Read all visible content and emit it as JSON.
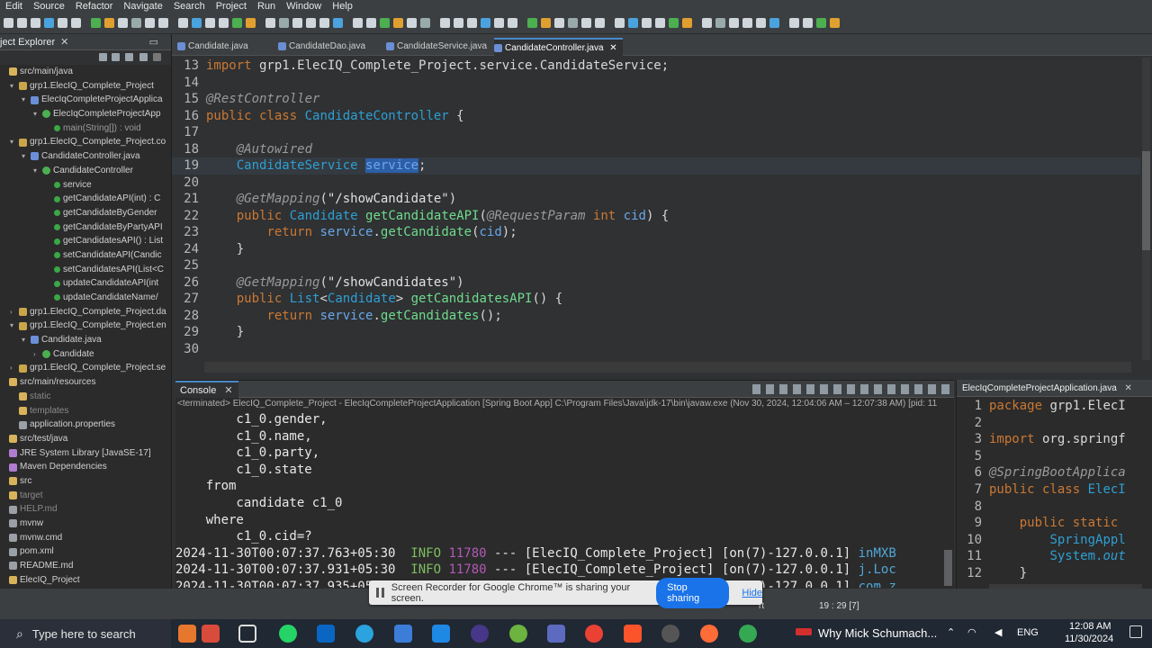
{
  "menu": [
    "Edit",
    "Source",
    "Refactor",
    "Navigate",
    "Search",
    "Project",
    "Run",
    "Window",
    "Help"
  ],
  "project_explorer": {
    "title": "ject Explorer",
    "rows": [
      {
        "indent": 0,
        "arrow": "",
        "icon": "fold",
        "text": "src/main/java",
        "cls": ""
      },
      {
        "indent": 1,
        "arrow": "▾",
        "icon": "pkg",
        "text": "grp1.ElecIQ_Complete_Project",
        "cls": ""
      },
      {
        "indent": 2,
        "arrow": "▾",
        "icon": "java",
        "text": "ElecIqCompleteProjectApplica",
        "cls": ""
      },
      {
        "indent": 3,
        "arrow": "▾",
        "icon": "cls",
        "text": "ElecIqCompleteProjectApp",
        "cls": ""
      },
      {
        "indent": 4,
        "arrow": "",
        "icon": "meth",
        "text": "main(String[]) : void",
        "cls": "main"
      },
      {
        "indent": 1,
        "arrow": "▾",
        "icon": "pkg",
        "text": "grp1.ElecIQ_Complete_Project.co",
        "cls": ""
      },
      {
        "indent": 2,
        "arrow": "▾",
        "icon": "java",
        "text": "CandidateController.java",
        "cls": ""
      },
      {
        "indent": 3,
        "arrow": "▾",
        "icon": "cls",
        "text": "CandidateController",
        "cls": ""
      },
      {
        "indent": 4,
        "arrow": "",
        "icon": "meth",
        "text": "service",
        "cls": ""
      },
      {
        "indent": 4,
        "arrow": "",
        "icon": "meth",
        "text": "getCandidateAPI(int) : C",
        "cls": ""
      },
      {
        "indent": 4,
        "arrow": "",
        "icon": "meth",
        "text": "getCandidateByGender",
        "cls": ""
      },
      {
        "indent": 4,
        "arrow": "",
        "icon": "meth",
        "text": "getCandidateByPartyAPI",
        "cls": ""
      },
      {
        "indent": 4,
        "arrow": "",
        "icon": "meth",
        "text": "getCandidatesAPI() : List",
        "cls": ""
      },
      {
        "indent": 4,
        "arrow": "",
        "icon": "meth",
        "text": "setCandidateAPI(Candic",
        "cls": ""
      },
      {
        "indent": 4,
        "arrow": "",
        "icon": "meth",
        "text": "setCandidatesAPI(List<C",
        "cls": ""
      },
      {
        "indent": 4,
        "arrow": "",
        "icon": "meth",
        "text": "updateCandidateAPI(int",
        "cls": ""
      },
      {
        "indent": 4,
        "arrow": "",
        "icon": "meth",
        "text": "updateCandidateName/",
        "cls": ""
      },
      {
        "indent": 1,
        "arrow": "›",
        "icon": "pkg",
        "text": "grp1.ElecIQ_Complete_Project.da",
        "cls": ""
      },
      {
        "indent": 1,
        "arrow": "▾",
        "icon": "pkg",
        "text": "grp1.ElecIQ_Complete_Project.en",
        "cls": ""
      },
      {
        "indent": 2,
        "arrow": "▾",
        "icon": "java",
        "text": "Candidate.java",
        "cls": ""
      },
      {
        "indent": 3,
        "arrow": "›",
        "icon": "cls",
        "text": "Candidate",
        "cls": ""
      },
      {
        "indent": 1,
        "arrow": "›",
        "icon": "pkg",
        "text": "grp1.ElecIQ_Complete_Project.se",
        "cls": ""
      },
      {
        "indent": 0,
        "arrow": "",
        "icon": "fold",
        "text": "src/main/resources",
        "cls": ""
      },
      {
        "indent": 1,
        "arrow": "",
        "icon": "fold",
        "text": "static",
        "cls": "dim"
      },
      {
        "indent": 1,
        "arrow": "",
        "icon": "fold",
        "text": "templates",
        "cls": "dim"
      },
      {
        "indent": 1,
        "arrow": "",
        "icon": "file",
        "text": "application.properties",
        "cls": ""
      },
      {
        "indent": 0,
        "arrow": "",
        "icon": "fold",
        "text": "src/test/java",
        "cls": ""
      },
      {
        "indent": 0,
        "arrow": "",
        "icon": "lib",
        "text": "JRE System Library [JavaSE-17]",
        "cls": ""
      },
      {
        "indent": 0,
        "arrow": "",
        "icon": "lib",
        "text": "Maven Dependencies",
        "cls": ""
      },
      {
        "indent": 0,
        "arrow": "",
        "icon": "fold",
        "text": "src",
        "cls": ""
      },
      {
        "indent": 0,
        "arrow": "",
        "icon": "fold",
        "text": "target",
        "cls": "dim"
      },
      {
        "indent": 0,
        "arrow": "",
        "icon": "file",
        "text": "HELP.md",
        "cls": "dim"
      },
      {
        "indent": 0,
        "arrow": "",
        "icon": "file",
        "text": "mvnw",
        "cls": ""
      },
      {
        "indent": 0,
        "arrow": "",
        "icon": "file",
        "text": "mvnw.cmd",
        "cls": ""
      },
      {
        "indent": 0,
        "arrow": "",
        "icon": "file",
        "text": "pom.xml",
        "cls": ""
      },
      {
        "indent": 0,
        "arrow": "",
        "icon": "file",
        "text": "README.md",
        "cls": ""
      },
      {
        "indent": 0,
        "arrow": "",
        "icon": "fold",
        "text": "ElecIQ_Project",
        "cls": ""
      }
    ]
  },
  "editor_tabs": [
    {
      "label": "Candidate.java",
      "active": false
    },
    {
      "label": "CandidateDao.java",
      "active": false
    },
    {
      "label": "CandidateService.java",
      "active": false
    },
    {
      "label": "CandidateController.java",
      "active": true
    }
  ],
  "code_lines": [
    {
      "n": "13",
      "html": "<span class=\"kw\">import</span> grp1.ElecIQ_Complete_Project.service.CandidateService;"
    },
    {
      "n": "14",
      "html": ""
    },
    {
      "n": "15",
      "html": "<span class=\"an\">@RestController</span>"
    },
    {
      "n": "16",
      "html": "<span class=\"kw\">public class</span> <span class=\"ty\">CandidateController</span> {"
    },
    {
      "n": "17",
      "html": ""
    },
    {
      "n": "18",
      "html": "    <span class=\"an\">@Autowired</span>"
    },
    {
      "n": "19",
      "html": "    <span class=\"ty\">CandidateService</span> <span class=\"va sel\">service</span>;",
      "cur": true
    },
    {
      "n": "20",
      "html": ""
    },
    {
      "n": "21",
      "html": "    <span class=\"an\">@GetMapping</span>(<span class=\"str\">\"/showCandidate\"</span>)"
    },
    {
      "n": "22",
      "html": "    <span class=\"kw\">public</span> <span class=\"ty\">Candidate</span> <span class=\"fn\">getCandidateAPI</span>(<span class=\"an\">@RequestParam</span> <span class=\"kw\">int</span> <span class=\"va\">cid</span>) {"
    },
    {
      "n": "23",
      "html": "        <span class=\"kw\">return</span> <span class=\"va\">service</span>.<span class=\"fn\">getCandidate</span>(<span class=\"va\">cid</span>);"
    },
    {
      "n": "24",
      "html": "    }"
    },
    {
      "n": "25",
      "html": ""
    },
    {
      "n": "26",
      "html": "    <span class=\"an\">@GetMapping</span>(<span class=\"str\">\"/showCandidates\"</span>)"
    },
    {
      "n": "27",
      "html": "    <span class=\"kw\">public</span> <span class=\"ty\">List</span>&lt;<span class=\"ty\">Candidate</span>&gt; <span class=\"fn\">getCandidatesAPI</span>() {"
    },
    {
      "n": "28",
      "html": "        <span class=\"kw\">return</span> <span class=\"va\">service</span>.<span class=\"fn\">getCandidates</span>();"
    },
    {
      "n": "29",
      "html": "    }"
    },
    {
      "n": "30",
      "html": ""
    }
  ],
  "console": {
    "tab": "Console",
    "terminated": "<terminated> ElecIQ_Complete_Project - ElecIqCompleteProjectApplication [Spring Boot App] C:\\Program Files\\Java\\jdk-17\\bin\\javaw.exe  (Nov 30, 2024, 12:04:06 AM – 12:07:38 AM) [pid: 11",
    "lines": [
      {
        "html": "        c1_0.gender,"
      },
      {
        "html": "        c1_0.name,"
      },
      {
        "html": "        c1_0.party,"
      },
      {
        "html": "        c1_0.state"
      },
      {
        "html": "    from"
      },
      {
        "html": "        candidate c1_0"
      },
      {
        "html": "    where"
      },
      {
        "html": "        c1_0.cid=?"
      },
      {
        "html": "2024-11-30T00:07:37.763+05:30  <span class=\"inf\">INFO</span> <span class=\"pid\">11780</span> --- [ElecIQ_Complete_Project] [on(7)-127.0.0.1] <span class=\"cls2\">inMXB</span>"
      },
      {
        "html": "2024-11-30T00:07:37.931+05:30  <span class=\"inf\">INFO</span> <span class=\"pid\">11780</span> --- [ElecIQ_Complete_Project] [on(7)-127.0.0.1] <span class=\"cls2\">j.Loc</span>"
      },
      {
        "html": "2024-11-30T00:07:37.935+05:30  <span class=\"inf\">INFO</span> <span class=\"pid\">11780</span> --- [ElecIQ_Complete_Project] [on(7)-127.0.0.1] <span class=\"cls2\">com.z</span>"
      }
    ]
  },
  "right_panel": {
    "tab": "ElecIqCompleteProjectApplication.java",
    "lines": [
      {
        "n": "1",
        "html": "<span class=\"kw\">package</span> grp1.ElecI"
      },
      {
        "n": "2",
        "html": ""
      },
      {
        "n": "3",
        "html": "<span class=\"kw\">import</span> org.springf"
      },
      {
        "n": "5",
        "html": ""
      },
      {
        "n": "6",
        "html": "<span class=\"an\">@SpringBootApplica</span>"
      },
      {
        "n": "7",
        "html": "<span class=\"kw\">public class</span> <span class=\"ty\">ElecI</span>"
      },
      {
        "n": "8",
        "html": ""
      },
      {
        "n": "9",
        "html": "    <span class=\"kw\">public static</span> "
      },
      {
        "n": "10",
        "html": "        <span class=\"ty\">SpringAppl</span>"
      },
      {
        "n": "11",
        "html": "        <span class=\"ty\">System.<i>out</i></span>"
      },
      {
        "n": "12",
        "html": "    }"
      }
    ]
  },
  "share_bar": {
    "message": "Screen Recorder for Google Chrome™ is sharing your screen.",
    "stop_label": "Stop sharing",
    "hide_label": "Hide"
  },
  "status": {
    "position": "19 : 29 [7]",
    "insert": "rt"
  },
  "taskbar": {
    "search_placeholder": "Type here to search",
    "now_playing": "Why Mick Schumach...",
    "lang": "ENG",
    "time": "12:08 AM",
    "date": "11/30/2024"
  }
}
